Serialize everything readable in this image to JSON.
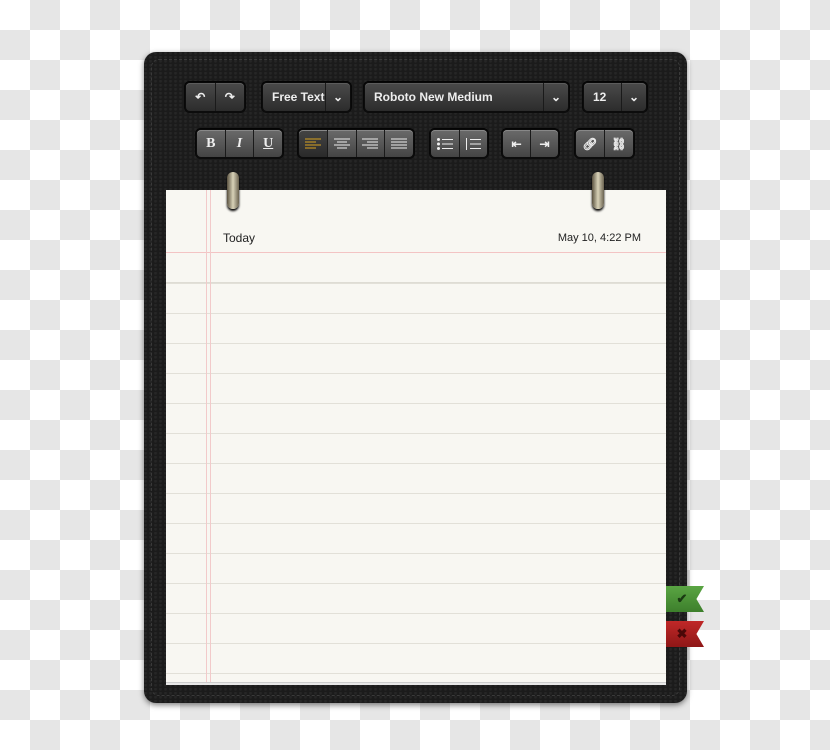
{
  "toolbar": {
    "style_select": {
      "value": "Free Text"
    },
    "font_select": {
      "value": "Roboto New Medium"
    },
    "size_select": {
      "value": "12"
    },
    "format": {
      "bold": "B",
      "italic": "I",
      "underline": "U"
    },
    "active_alignment": "left",
    "accent_color": "#d9a321"
  },
  "note": {
    "title": "Today",
    "timestamp": "May 10, 4:22 PM"
  },
  "actions": {
    "confirm_icon": "check-icon",
    "cancel_icon": "x-icon",
    "confirm_color": "#4f9a3a",
    "cancel_color": "#b02020"
  }
}
